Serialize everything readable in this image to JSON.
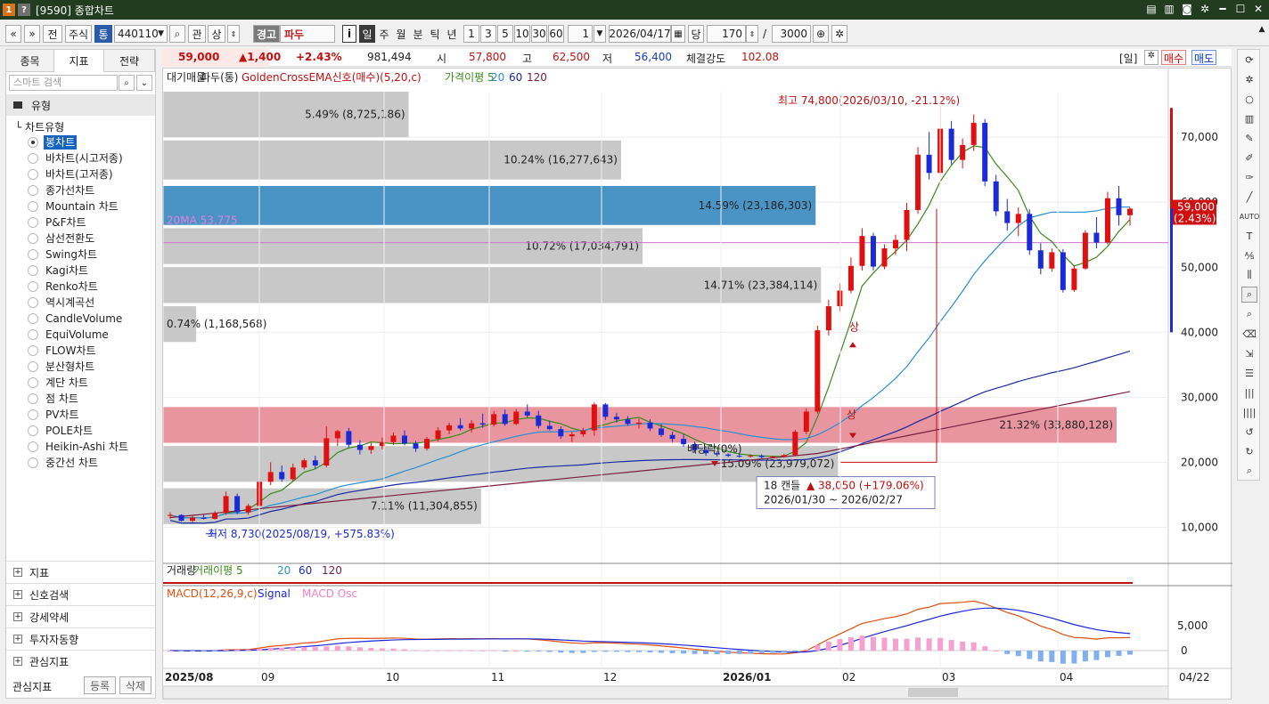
{
  "titlebar": {
    "badge1": "1",
    "badge2": "?",
    "title": "[9590] 종합차트",
    "icons": [
      "memo-icon",
      "memo2-icon",
      "camera-icon",
      "gear-icon",
      "minimize-icon",
      "maximize-icon",
      "close-icon"
    ]
  },
  "toolbar": {
    "prev": "«",
    "next": "»",
    "jeon": "전",
    "market": "주식",
    "tong": "통",
    "code": "440110",
    "q": "관",
    "s": "상",
    "warn": "경고",
    "name": "파두",
    "info": "i",
    "periods": [
      "일",
      "주",
      "월",
      "분",
      "틱",
      "년"
    ],
    "mins": [
      "1",
      "3",
      "5",
      "10",
      "30",
      "60"
    ],
    "count_sel": "1",
    "date": "2026/04/17",
    "dang": "당",
    "view_count": "170",
    "slash": "/",
    "total": "3000"
  },
  "left": {
    "tabs": [
      "종목",
      "지표",
      "전략"
    ],
    "search_placeholder": "스마트 검색",
    "type_header": "유형",
    "tree_root": "차트유형",
    "chart_types": [
      "봉차트",
      "바차트(시고저종)",
      "바차트(고저종)",
      "종가선차트",
      "Mountain 차트",
      "P&F차트",
      "삼선전환도",
      "Swing차트",
      "Kagi차트",
      "Renko차트",
      "역시계곡선",
      "CandleVolume",
      "EquiVolume",
      "FLOW차트",
      "분산형차트",
      "계단 차트",
      "점 차트",
      "PV차트",
      "POLE차트",
      "Heikin-Ashi 차트",
      "중간선 차트"
    ],
    "selected": 0,
    "sections": [
      "지표",
      "신호검색",
      "강세약세",
      "투자자동향",
      "관심지표"
    ],
    "fav_label": "관심지표",
    "fav_add": "등록",
    "fav_del": "삭제"
  },
  "quote": {
    "price": "59,000",
    "change": "▲1,400",
    "rate": "+2.43%",
    "volume": "981,494",
    "open_l": "시",
    "open": "57,800",
    "high_l": "고",
    "high": "62,500",
    "low_l": "저",
    "low": "56,400",
    "strength_l": "체결강도",
    "strength": "102.08",
    "period": "[일]",
    "buy": "매수",
    "sell": "매도"
  },
  "legend": {
    "items": [
      "대기매물",
      "파두(통)",
      "GoldenCrossEMA신호(매수)(5,20,c)",
      "가격이평 5",
      "20",
      "60",
      "120"
    ]
  },
  "volume_legend": [
    "거래량",
    "거래이평 5",
    "20",
    "60",
    "120"
  ],
  "macd_legend": [
    "MACD(12,26,9,c)",
    "Signal",
    "MACD Osc"
  ],
  "chart_data": {
    "type": "candlestick",
    "title": "파두(통)",
    "y_ticks": [
      "70,000",
      "60,000",
      "50,000",
      "40,000",
      "30,000",
      "20,000",
      "10,000"
    ],
    "ylim": [
      5000,
      77000
    ],
    "x_ticks": [
      "2025/08",
      "09",
      "10",
      "11",
      "12",
      "2026/01",
      "02",
      "03",
      "04"
    ],
    "x_end": "04/22",
    "current_price": "59,000",
    "current_rate": "(2.43%)",
    "ma20_label": "20MA 53,775",
    "high_label": "최고 74,800(2026/03/10, -21.12%)",
    "low_label": "최저 8,730(2025/08/19, +575.83%)",
    "div_label": "배당락(0%)",
    "range_box": {
      "line1": "18 캔들",
      "line2": "▲ 38,050 (+179.06%)",
      "line3": "2026/01/30 ~ 2026/02/27"
    },
    "signal_labels": [
      "상",
      "상"
    ],
    "volume_profile": [
      {
        "label": "5.49% (8,725,186)",
        "low": 70000,
        "high": 77000,
        "pct": 5.49,
        "type": "gray"
      },
      {
        "label": "10.24% (16,277,643)",
        "low": 63500,
        "high": 69500,
        "pct": 10.24,
        "type": "gray"
      },
      {
        "label": "14.59% (23,186,303)",
        "low": 56500,
        "high": 62500,
        "pct": 14.59,
        "type": "blue"
      },
      {
        "label": "10.72% (17,034,791)",
        "low": 50500,
        "high": 56000,
        "pct": 10.72,
        "type": "gray"
      },
      {
        "label": "14.71% (23,384,114)",
        "low": 44500,
        "high": 50000,
        "pct": 14.71,
        "type": "gray"
      },
      {
        "label": "0.74% (1,168,568)",
        "low": 38500,
        "high": 44000,
        "pct": 0.74,
        "type": "gray"
      },
      {
        "label": "21.32% (33,880,128)",
        "low": 23000,
        "high": 28500,
        "pct": 21.32,
        "type": "red"
      },
      {
        "label": "15.09% (23,979,072)",
        "low": 17000,
        "high": 22500,
        "pct": 15.09,
        "type": "gray"
      },
      {
        "label": "7.11% (11,304,855)",
        "low": 10500,
        "high": 16000,
        "pct": 7.11,
        "type": "gray"
      }
    ],
    "candles": [
      [
        11800,
        12300,
        11300,
        11900
      ],
      [
        11900,
        12000,
        10900,
        11000
      ],
      [
        11000,
        11800,
        10800,
        11500
      ],
      [
        11500,
        12000,
        11200,
        11300
      ],
      [
        11300,
        12500,
        11200,
        12200
      ],
      [
        12200,
        15500,
        11900,
        14800
      ],
      [
        14800,
        15200,
        12000,
        12300
      ],
      [
        12300,
        13600,
        11900,
        13300
      ],
      [
        13300,
        17500,
        13000,
        17000
      ],
      [
        17000,
        20000,
        16500,
        18500
      ],
      [
        18500,
        19500,
        17000,
        17400
      ],
      [
        17400,
        19800,
        17100,
        19200
      ],
      [
        19200,
        20600,
        18900,
        20300
      ],
      [
        20300,
        21000,
        19000,
        19500
      ],
      [
        19500,
        25500,
        19200,
        23700
      ],
      [
        23700,
        25000,
        22500,
        24800
      ],
      [
        24800,
        25300,
        22300,
        22700
      ],
      [
        22700,
        23400,
        21200,
        21900
      ],
      [
        21900,
        23000,
        21300,
        22500
      ],
      [
        22500,
        23800,
        22000,
        23100
      ],
      [
        23100,
        24600,
        22700,
        24100
      ],
      [
        24100,
        24900,
        22600,
        22900
      ],
      [
        22900,
        23300,
        21600,
        22100
      ],
      [
        22100,
        23900,
        21800,
        23600
      ],
      [
        23600,
        25400,
        23200,
        24900
      ],
      [
        24900,
        26100,
        24300,
        25700
      ],
      [
        25700,
        26800,
        24900,
        25200
      ],
      [
        25200,
        26500,
        24600,
        26000
      ],
      [
        26000,
        27500,
        25300,
        25800
      ],
      [
        25800,
        27900,
        25500,
        27400
      ],
      [
        27400,
        28100,
        25600,
        25900
      ],
      [
        25900,
        28200,
        25700,
        27800
      ],
      [
        27800,
        28900,
        26900,
        27200
      ],
      [
        27200,
        27900,
        25200,
        25600
      ],
      [
        25600,
        26400,
        24900,
        25100
      ],
      [
        25100,
        25500,
        23600,
        24000
      ],
      [
        24000,
        24700,
        23100,
        24300
      ],
      [
        24300,
        25300,
        23900,
        24900
      ],
      [
        24900,
        29200,
        24100,
        28900
      ],
      [
        28900,
        29100,
        26500,
        27000
      ],
      [
        27000,
        27600,
        26100,
        26600
      ],
      [
        26600,
        27100,
        25600,
        25900
      ],
      [
        25900,
        26700,
        25200,
        26100
      ],
      [
        26100,
        26600,
        24800,
        25200
      ],
      [
        25200,
        25900,
        23900,
        24200
      ],
      [
        24200,
        24700,
        23100,
        23600
      ],
      [
        23600,
        24300,
        22400,
        22800
      ],
      [
        22800,
        23200,
        21500,
        21900
      ],
      [
        21900,
        22400,
        21000,
        21400
      ],
      [
        21400,
        21700,
        20900,
        21200
      ],
      [
        21200,
        21400,
        20800,
        21000
      ],
      [
        21000,
        21300,
        20700,
        20900
      ],
      [
        20900,
        21200,
        20700,
        21000
      ],
      [
        21000,
        21200,
        20600,
        20800
      ],
      [
        20800,
        21000,
        20600,
        20900
      ],
      [
        20900,
        21300,
        20700,
        21100
      ],
      [
        21100,
        25000,
        20900,
        24700
      ],
      [
        24700,
        28300,
        24300,
        27800
      ],
      [
        27800,
        41000,
        27500,
        40300
      ],
      [
        40300,
        45000,
        39500,
        44000
      ],
      [
        44000,
        47500,
        43200,
        46400
      ],
      [
        46400,
        51500,
        46000,
        50200
      ],
      [
        50200,
        56000,
        49500,
        54800
      ],
      [
        54800,
        55300,
        49500,
        50100
      ],
      [
        50100,
        53500,
        49700,
        52900
      ],
      [
        52900,
        55000,
        51900,
        54200
      ],
      [
        54200,
        59900,
        52500,
        58800
      ],
      [
        58800,
        68500,
        58200,
        67300
      ],
      [
        67300,
        70800,
        63500,
        64500
      ],
      [
        64500,
        74800,
        64000,
        71300
      ],
      [
        71300,
        72500,
        65800,
        66500
      ],
      [
        66500,
        69800,
        65200,
        68800
      ],
      [
        68800,
        73500,
        67900,
        72200
      ],
      [
        72200,
        72800,
        62500,
        63200
      ],
      [
        63200,
        64200,
        57900,
        58600
      ],
      [
        58600,
        60500,
        55600,
        56800
      ],
      [
        56800,
        59200,
        54800,
        58200
      ],
      [
        58200,
        58900,
        51900,
        52600
      ],
      [
        52600,
        53700,
        48900,
        49800
      ],
      [
        49800,
        52900,
        49300,
        52300
      ],
      [
        52300,
        52800,
        46100,
        46500
      ],
      [
        46500,
        50300,
        46200,
        49800
      ],
      [
        49800,
        55700,
        49600,
        55300
      ],
      [
        55300,
        57700,
        52900,
        53800
      ],
      [
        53800,
        61600,
        53500,
        60600
      ],
      [
        60600,
        62500,
        56400,
        58000
      ],
      [
        58000,
        59200,
        56400,
        59000
      ]
    ]
  }
}
